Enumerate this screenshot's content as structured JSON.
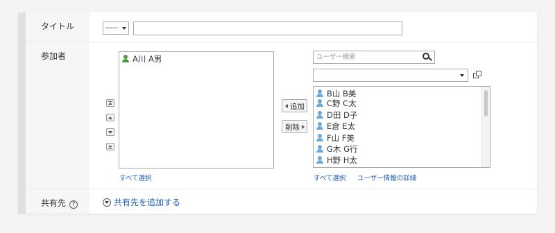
{
  "colors": {
    "link": "#1a5bb5",
    "selected_user_icon": "#4a9b3a",
    "candidate_user_icon": "#6aaad9"
  },
  "title_row": {
    "label": "タイトル",
    "prefix_select": {
      "value": "-----",
      "icon": "caret-down-icon"
    },
    "title_value": ""
  },
  "attendees_row": {
    "label": "参加者",
    "selected": [
      {
        "name": "A川 A男",
        "icon": "user-icon"
      }
    ],
    "order_buttons": {
      "top": "move-top-icon",
      "up": "move-up-icon",
      "down": "move-down-icon",
      "bottom": "move-bottom-icon"
    },
    "add_button": "追加",
    "remove_button": "削除",
    "search": {
      "placeholder": "ユーザー検索",
      "icon": "search-icon"
    },
    "group_select": {
      "value": "",
      "icon": "caret-down-icon"
    },
    "popup_icon": "popup-window-icon",
    "candidates": [
      {
        "name": "B山 B美"
      },
      {
        "name": "C野 C太"
      },
      {
        "name": "D田 D子"
      },
      {
        "name": "E倉 E太"
      },
      {
        "name": "F山 F美"
      },
      {
        "name": "G木 G行"
      },
      {
        "name": "H野 H太"
      }
    ],
    "select_all_left": "すべて選択",
    "select_all_right": "すべて選択",
    "user_details": "ユーザー情報の詳細"
  },
  "share_row": {
    "label": "共有先",
    "help_icon": "help-icon",
    "add_share": "共有先を追加する",
    "add_share_icon": "circle-chevron-down-icon"
  }
}
